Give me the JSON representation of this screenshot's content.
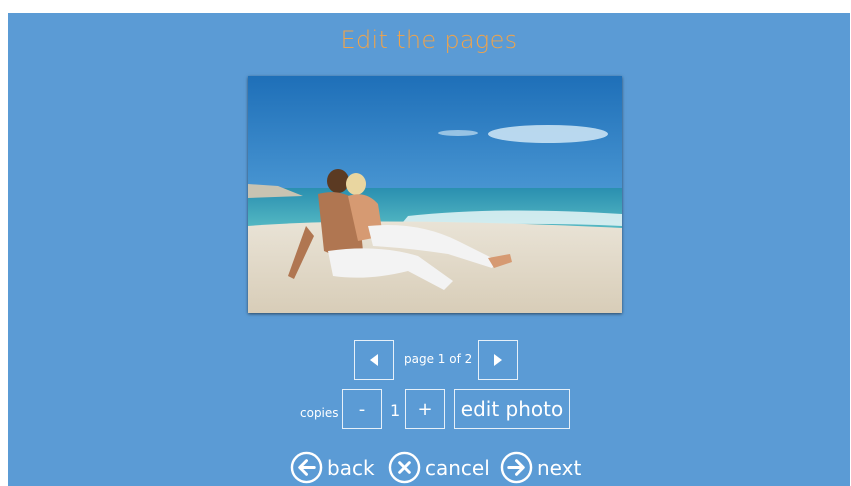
{
  "header": {
    "title": "Edit the pages"
  },
  "pager": {
    "label": "page 1 of 2",
    "prev_icon": "triangle-left-icon",
    "next_icon": "triangle-right-icon"
  },
  "copies": {
    "label": "copies",
    "minus": "-",
    "value": "1",
    "plus": "+"
  },
  "actions": {
    "edit_photo": "edit photo",
    "back": "back",
    "cancel": "cancel",
    "next": "next"
  },
  "colors": {
    "background": "#5b9bd5",
    "title": "#f0a34a",
    "text": "#ffffff"
  }
}
